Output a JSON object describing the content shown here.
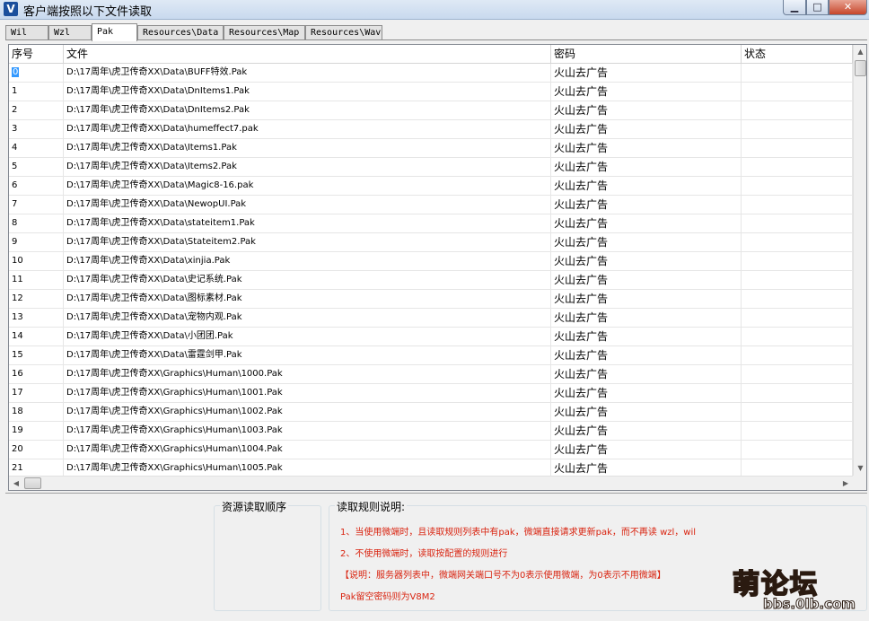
{
  "window": {
    "title": "客户端按照以下文件读取",
    "app_icon": "V",
    "controls": {
      "minimize": "▁",
      "maximize": "□",
      "close": "✕"
    }
  },
  "tabs": [
    {
      "label": "Wil",
      "active": false
    },
    {
      "label": "Wzl",
      "active": false
    },
    {
      "label": "Pak",
      "active": true
    },
    {
      "label": "Resources\\Data",
      "active": false
    },
    {
      "label": "Resources\\Map",
      "active": false
    },
    {
      "label": "Resources\\Wav",
      "active": false
    }
  ],
  "table": {
    "columns": [
      "序号",
      "文件",
      "密码",
      "状态"
    ],
    "rows": [
      {
        "idx": "0",
        "file": "D:\\17周年\\虎卫传奇XX\\Data\\BUFF特效.Pak",
        "password": "火山去广告",
        "status": ""
      },
      {
        "idx": "1",
        "file": "D:\\17周年\\虎卫传奇XX\\Data\\DnItems1.Pak",
        "password": "火山去广告",
        "status": ""
      },
      {
        "idx": "2",
        "file": "D:\\17周年\\虎卫传奇XX\\Data\\DnItems2.Pak",
        "password": "火山去广告",
        "status": ""
      },
      {
        "idx": "3",
        "file": "D:\\17周年\\虎卫传奇XX\\Data\\humeffect7.pak",
        "password": "火山去广告",
        "status": ""
      },
      {
        "idx": "4",
        "file": "D:\\17周年\\虎卫传奇XX\\Data\\Items1.Pak",
        "password": "火山去广告",
        "status": ""
      },
      {
        "idx": "5",
        "file": "D:\\17周年\\虎卫传奇XX\\Data\\Items2.Pak",
        "password": "火山去广告",
        "status": ""
      },
      {
        "idx": "6",
        "file": "D:\\17周年\\虎卫传奇XX\\Data\\Magic8-16.pak",
        "password": "火山去广告",
        "status": ""
      },
      {
        "idx": "7",
        "file": "D:\\17周年\\虎卫传奇XX\\Data\\NewopUI.Pak",
        "password": "火山去广告",
        "status": ""
      },
      {
        "idx": "8",
        "file": "D:\\17周年\\虎卫传奇XX\\Data\\stateitem1.Pak",
        "password": "火山去广告",
        "status": ""
      },
      {
        "idx": "9",
        "file": "D:\\17周年\\虎卫传奇XX\\Data\\Stateitem2.Pak",
        "password": "火山去广告",
        "status": ""
      },
      {
        "idx": "10",
        "file": "D:\\17周年\\虎卫传奇XX\\Data\\xinjia.Pak",
        "password": "火山去广告",
        "status": ""
      },
      {
        "idx": "11",
        "file": "D:\\17周年\\虎卫传奇XX\\Data\\史记系统.Pak",
        "password": "火山去广告",
        "status": ""
      },
      {
        "idx": "12",
        "file": "D:\\17周年\\虎卫传奇XX\\Data\\图标素材.Pak",
        "password": "火山去广告",
        "status": ""
      },
      {
        "idx": "13",
        "file": "D:\\17周年\\虎卫传奇XX\\Data\\宠物内观.Pak",
        "password": "火山去广告",
        "status": ""
      },
      {
        "idx": "14",
        "file": "D:\\17周年\\虎卫传奇XX\\Data\\小团团.Pak",
        "password": "火山去广告",
        "status": ""
      },
      {
        "idx": "15",
        "file": "D:\\17周年\\虎卫传奇XX\\Data\\雷霆剑甲.Pak",
        "password": "火山去广告",
        "status": ""
      },
      {
        "idx": "16",
        "file": "D:\\17周年\\虎卫传奇XX\\Graphics\\Human\\1000.Pak",
        "password": "火山去广告",
        "status": ""
      },
      {
        "idx": "17",
        "file": "D:\\17周年\\虎卫传奇XX\\Graphics\\Human\\1001.Pak",
        "password": "火山去广告",
        "status": ""
      },
      {
        "idx": "18",
        "file": "D:\\17周年\\虎卫传奇XX\\Graphics\\Human\\1002.Pak",
        "password": "火山去广告",
        "status": ""
      },
      {
        "idx": "19",
        "file": "D:\\17周年\\虎卫传奇XX\\Graphics\\Human\\1003.Pak",
        "password": "火山去广告",
        "status": ""
      },
      {
        "idx": "20",
        "file": "D:\\17周年\\虎卫传奇XX\\Graphics\\Human\\1004.Pak",
        "password": "火山去广告",
        "status": ""
      },
      {
        "idx": "21",
        "file": "D:\\17周年\\虎卫传奇XX\\Graphics\\Human\\1005.Pak",
        "password": "火山去广告",
        "status": ""
      }
    ],
    "selected_index": 0
  },
  "scrollbars": {
    "up": "▲",
    "down": "▼",
    "left": "◀",
    "right": "▶"
  },
  "bottom": {
    "order_label": "资源读取顺序",
    "rules_label": "读取规则说明:",
    "rules": [
      "1、当使用微端时，且读取规则列表中有pak，微端直接请求更新pak，而不再读 wzl，wil",
      "2、不使用微端时，读取按配置的规则进行",
      "【说明：服务器列表中，微端网关端口号不为0表示使用微端，为0表示不用微端】",
      "Pak留空密码则为V8M2"
    ]
  },
  "watermark": {
    "main": "萌论坛",
    "sub": "bbs.0lb.com"
  },
  "colors": {
    "selection": "#3399ff",
    "rule_text": "#d9230f",
    "titlebar": "#c8d9ee"
  }
}
